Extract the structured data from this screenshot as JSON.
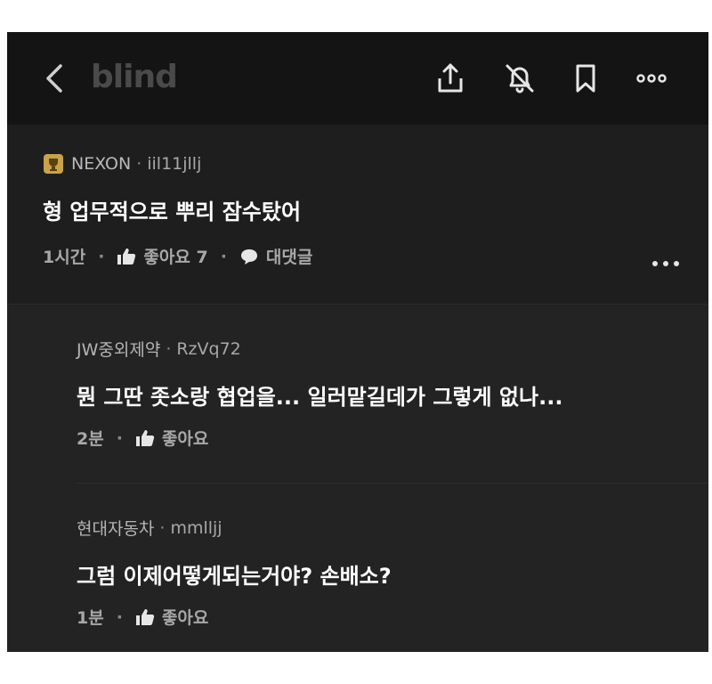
{
  "header": {
    "logo": "blind",
    "icons": [
      "back-arrow-icon",
      "share-icon",
      "bell-off-icon",
      "bookmark-icon",
      "more-horizontal-icon"
    ]
  },
  "post": {
    "company": "NEXON",
    "separator": "·",
    "nickname": "iil11jllj",
    "text": "형 업무적으로 뿌리 잠수탔어",
    "time": "1시간",
    "like_label": "좋아요 7",
    "reply_label": "대댓글"
  },
  "comments": [
    {
      "company": "JW중외제약",
      "nickname": "RzVq72",
      "text": "뭔 그딴 좃소랑 협업을... 일러맡길데가 그렇게 없나...",
      "time": "2분",
      "like_label": "좋아요"
    },
    {
      "company": "현대자동차",
      "nickname": "mmlljj",
      "text": "그럼 이제어떻게되는거야? 손배소?",
      "time": "1분",
      "like_label": "좋아요"
    }
  ],
  "colors": {
    "background": "#1e1e1e",
    "header": "#141414",
    "text": "#ffffff",
    "muted": "#a8a8a8",
    "badge": "#c9a24a"
  }
}
